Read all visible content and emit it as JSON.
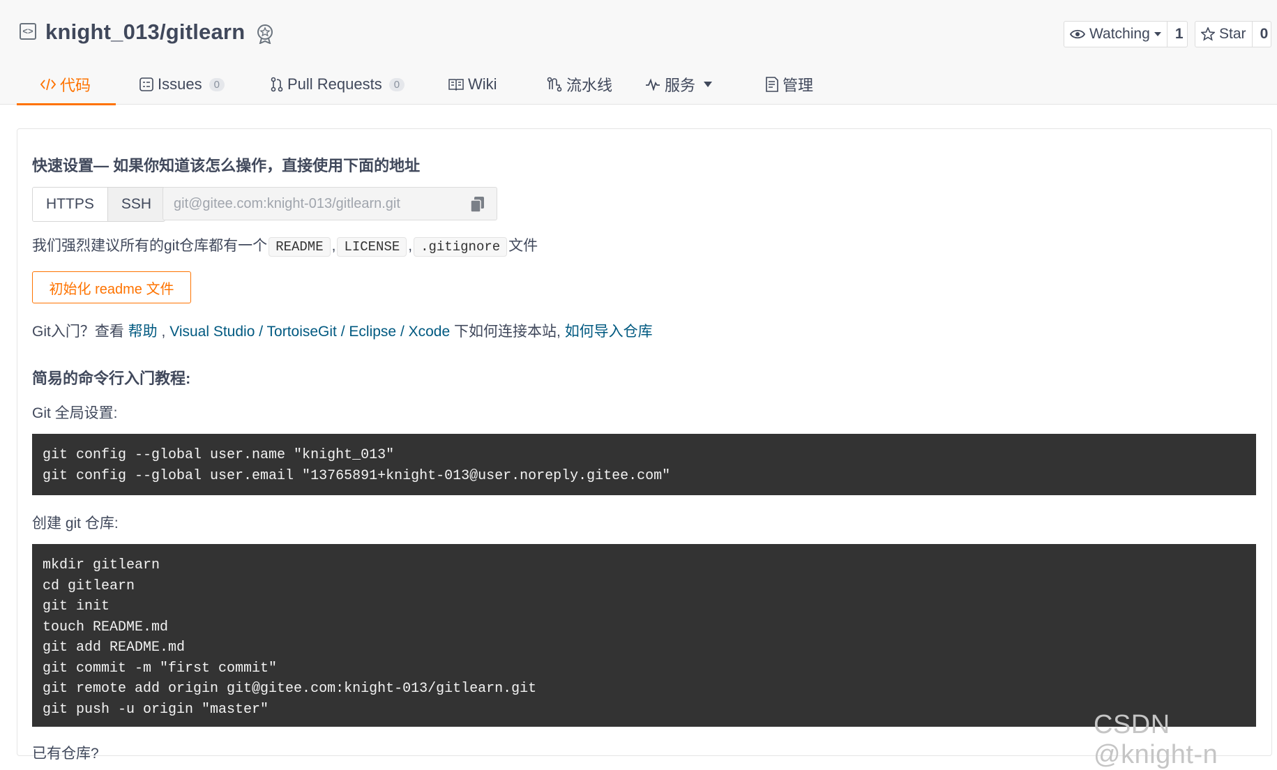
{
  "header": {
    "repo_title": "knight_013/gitlearn",
    "watch": {
      "label": "Watching",
      "count": "1"
    },
    "star": {
      "label": "Star",
      "count": "0"
    }
  },
  "tabs": [
    {
      "label": "代码",
      "icon": "code-icon",
      "active": true
    },
    {
      "label": "Issues",
      "count": "0",
      "icon": "issues-icon"
    },
    {
      "label": "Pull Requests",
      "count": "0",
      "icon": "pull-request-icon"
    },
    {
      "label": "Wiki",
      "icon": "book-icon"
    },
    {
      "label": "流水线",
      "icon": "pipeline-icon"
    },
    {
      "label": "服务",
      "icon": "pulse-icon",
      "dropdown": true
    },
    {
      "label": "管理",
      "icon": "manage-icon"
    }
  ],
  "quick_setup": {
    "title": "快速设置— 如果你知道该怎么操作，直接使用下面的地址",
    "protocols": [
      "HTTPS",
      "SSH"
    ],
    "selected_protocol": "SSH",
    "url": "git@gitee.com:knight-013/gitlearn.git"
  },
  "recommend": {
    "prefix": "我们强烈建议所有的git仓库都有一个",
    "files": [
      "README",
      "LICENSE",
      ".gitignore"
    ],
    "sep": ",",
    "suffix": "文件"
  },
  "init_button": "初始化 readme 文件",
  "help": {
    "prefix": "Git入门？查看 ",
    "help_link": "帮助",
    "comma": " , ",
    "tools": [
      "Visual Studio",
      "TortoiseGit",
      "Eclipse",
      "Xcode"
    ],
    "slash": " / ",
    "mid": " 下如何连接本站, ",
    "import_link": "如何导入仓库"
  },
  "tutorial": {
    "title": "简易的命令行入门教程:",
    "global_label": "Git 全局设置:",
    "global_code": "git config --global user.name \"knight_013\"\ngit config --global user.email \"13765891+knight-013@user.noreply.gitee.com\"",
    "create_label": "创建 git 仓库:",
    "create_code": "mkdir gitlearn\ncd gitlearn\ngit init\ntouch README.md\ngit add README.md\ngit commit -m \"first commit\"\ngit remote add origin git@gitee.com:knight-013/gitlearn.git\ngit push -u origin \"master\"",
    "existing_label": "已有仓库?"
  },
  "watermark": "CSDN @knight-n",
  "colors": {
    "accent": "#fe7300",
    "link": "#005980",
    "code_bg": "#333333"
  }
}
